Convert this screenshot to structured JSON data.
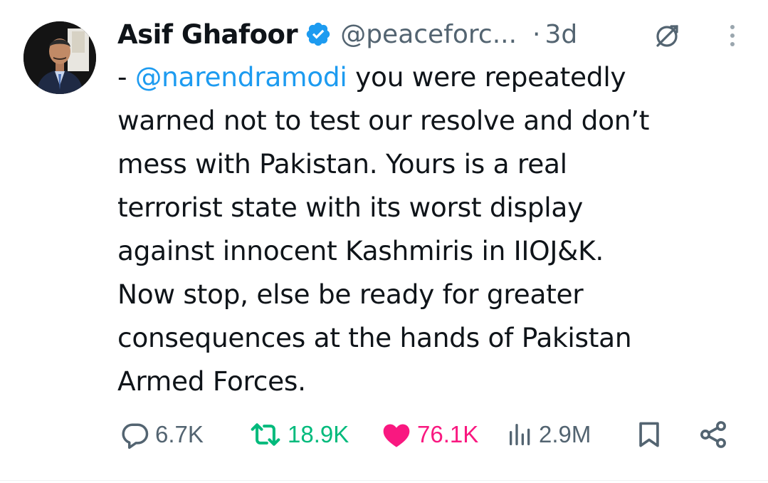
{
  "tweet": {
    "author_name": "Asif Ghafoor",
    "handle": "@peaceforc...",
    "separator": "·",
    "time_ago": "3d",
    "lines": [
      {
        "mention": "@narendramodi",
        "prefix": "- ",
        "text": " you were repeatedly"
      },
      {
        "text": "warned not to test our resolve and don’t"
      },
      {
        "text": "mess with Pakistan. Yours is a real"
      },
      {
        "text": "terrorist state with its worst display"
      },
      {
        "text": "against innocent Kashmiris in IIOJ&K."
      },
      {
        "text": "Now stop, else be ready for greater"
      },
      {
        "text": "consequences at the hands of Pakistan"
      },
      {
        "text": "Armed Forces."
      }
    ]
  },
  "actions": {
    "replies": "6.7K",
    "reposts": "18.9K",
    "likes": "76.1K",
    "views": "2.9M"
  },
  "colors": {
    "accent": "#1d9bf0",
    "secondary_text": "#536471",
    "repost_active": "#00ba7c",
    "like_active": "#f91880",
    "text": "#0f1419"
  },
  "icons": {
    "verified": "verified-badge-icon",
    "grok": "grok-icon",
    "more": "more-vertical-icon",
    "reply": "reply-icon",
    "repost": "repost-icon",
    "like": "heart-icon",
    "views": "views-icon",
    "bookmark": "bookmark-icon",
    "share": "share-icon"
  }
}
